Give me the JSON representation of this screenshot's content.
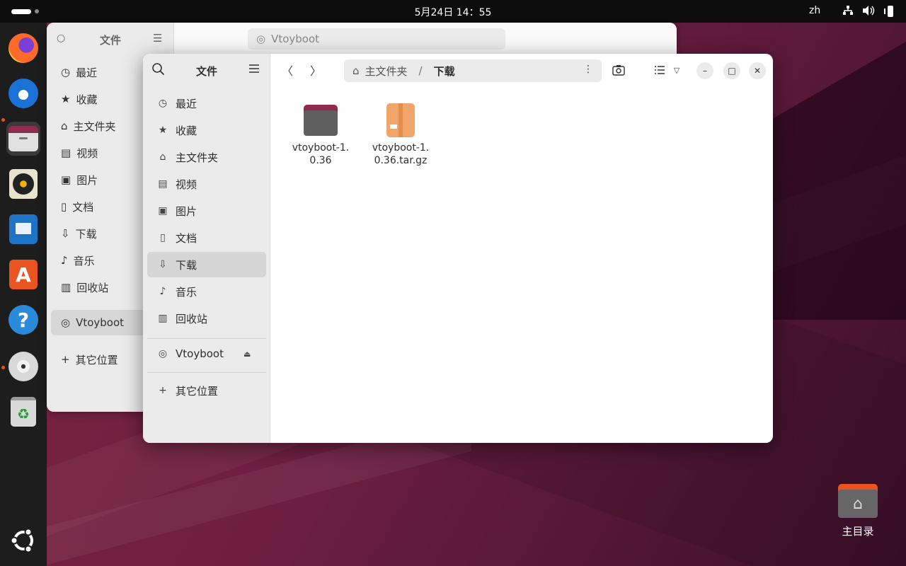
{
  "topbar": {
    "clock": "5月24日  14：55",
    "language": "zh",
    "tray_icons": [
      "network-icon",
      "volume-icon",
      "battery-icon"
    ]
  },
  "dock": {
    "items": [
      {
        "name": "firefox",
        "icon": "firefox-icon"
      },
      {
        "name": "thunderbird",
        "icon": "thunderbird-icon"
      },
      {
        "name": "files",
        "icon": "files-icon",
        "active": true
      },
      {
        "name": "rhythmbox",
        "icon": "rhythmbox-icon"
      },
      {
        "name": "writer",
        "icon": "writer-icon"
      },
      {
        "name": "app-center",
        "icon": "app-center-icon"
      },
      {
        "name": "help",
        "icon": "help-icon"
      },
      {
        "name": "disc",
        "icon": "disc-icon"
      },
      {
        "name": "trash",
        "icon": "trash-icon"
      },
      {
        "name": "show-apps",
        "icon": "ubuntu-icon"
      }
    ]
  },
  "back_window": {
    "title": "文件",
    "path_label": "Vtoyboot",
    "nav": [
      "最近",
      "收藏",
      "主文件夹",
      "视频",
      "图片",
      "文档",
      "下载",
      "音乐",
      "回收站",
      "Vtoyboot",
      "其它位置"
    ]
  },
  "window": {
    "title": "文件",
    "path": {
      "home": "主文件夹",
      "separator": "/",
      "current": "下载"
    },
    "nav": {
      "recent": "最近",
      "starred": "收藏",
      "home": "主文件夹",
      "videos": "视频",
      "pictures": "图片",
      "documents": "文档",
      "downloads": "下载",
      "music": "音乐",
      "trash": "回收站",
      "device": "Vtoyboot",
      "other": "其它位置"
    },
    "files": [
      {
        "name_line1": "vtoyboot-1.",
        "name_line2": "0.36",
        "type": "folder"
      },
      {
        "name_line1": "vtoyboot-1.",
        "name_line2": "0.36.tar.gz",
        "type": "archive"
      }
    ]
  },
  "desktop": {
    "home_label": "主目录"
  }
}
